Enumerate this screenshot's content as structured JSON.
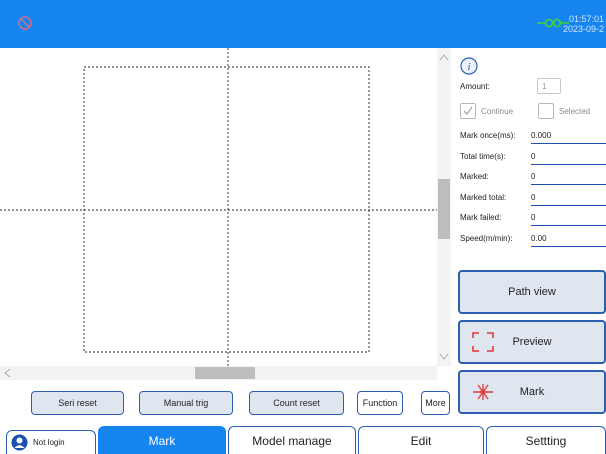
{
  "topbar": {
    "status_icon": "no-entry-icon",
    "connection_icon": "connection-icon",
    "time": "01:57:01",
    "date": "2023-09-2"
  },
  "canvas": {
    "scroll_up_icon": "chevron-up-icon",
    "scroll_down_icon": "chevron-down-icon",
    "scroll_left_icon": "chevron-left-icon"
  },
  "bottom_buttons": {
    "seri_reset": "Seri reset",
    "manual_trig": "Manual trig",
    "count_reset": "Count reset",
    "function": "Function",
    "more": "More"
  },
  "panel": {
    "info_icon": "info-icon",
    "amount_label": "Amount:",
    "amount_value": "1",
    "continue_label": "Continue",
    "continue_checked": true,
    "selected_label": "Selected",
    "selected_checked": false,
    "rows": [
      {
        "label": "Mark once(ms):",
        "value": "0.000"
      },
      {
        "label": "Total time(s):",
        "value": "0"
      },
      {
        "label": "Marked:",
        "value": "0"
      },
      {
        "label": "Marked total:",
        "value": "0"
      },
      {
        "label": "Mark failed:",
        "value": "0"
      },
      {
        "label": "Speed(m/min):",
        "value": "0.00"
      }
    ]
  },
  "actions": {
    "path_view": "Path view",
    "preview": "Preview",
    "mark": "Mark",
    "preview_icon": "preview-frame-icon",
    "mark_icon": "laser-burst-icon"
  },
  "tabs": {
    "login_label": "Not login",
    "login_icon": "user-icon",
    "mark": "Mark",
    "model_manage": "Model manage",
    "edit": "Edit",
    "settting": "Settting"
  },
  "colors": {
    "topbar": "#1685f0",
    "accent_border": "#2c5fb0",
    "connection_green": "#3fd23a",
    "mark_red": "#e53935"
  }
}
